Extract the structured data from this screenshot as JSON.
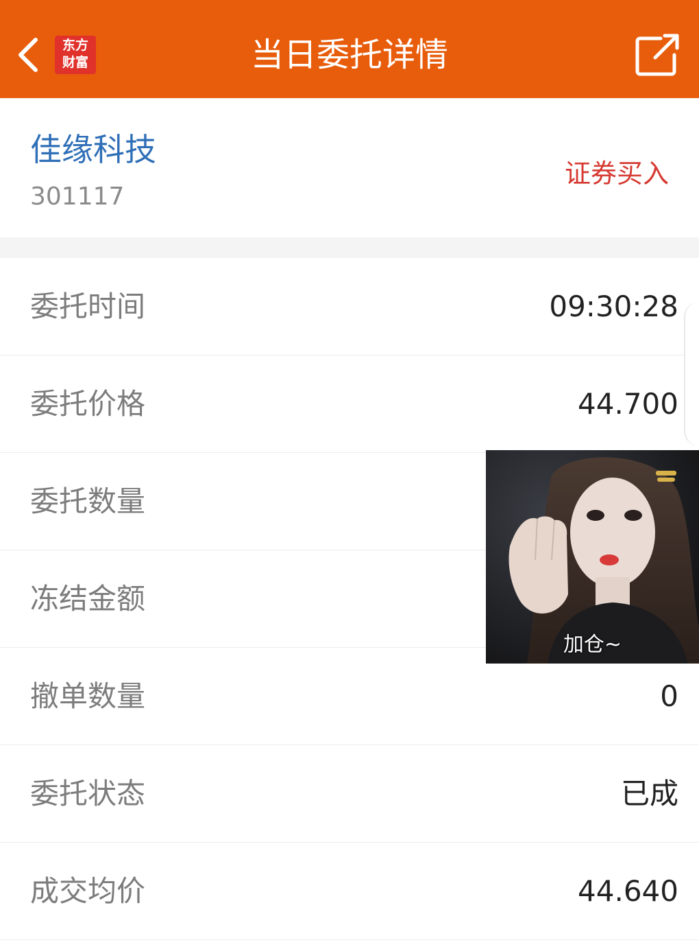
{
  "header": {
    "title": "当日委托详情",
    "logo_line1": "东方",
    "logo_line2": "财富",
    "back_icon": "chevron-left-icon",
    "share_icon": "share-external-icon",
    "background_color": "#e85d0c"
  },
  "stock": {
    "name": "佳缘科技",
    "code": "301117",
    "trade_type": "证券买入"
  },
  "details": [
    {
      "label": "委托时间",
      "value": "09:30:28"
    },
    {
      "label": "委托价格",
      "value": "44.700"
    },
    {
      "label": "委托数量",
      "value": ""
    },
    {
      "label": "冻结金额",
      "value": ""
    },
    {
      "label": "撤单数量",
      "value": "0"
    },
    {
      "label": "委托状态",
      "value": "已成"
    },
    {
      "label": "成交均价",
      "value": "44.640"
    }
  ],
  "overlay": {
    "caption": "加仓~"
  },
  "colors": {
    "accent": "#e85d0c",
    "stock_name": "#2f6fb7",
    "buy": "#d63a32",
    "label": "#7c7c7c"
  }
}
